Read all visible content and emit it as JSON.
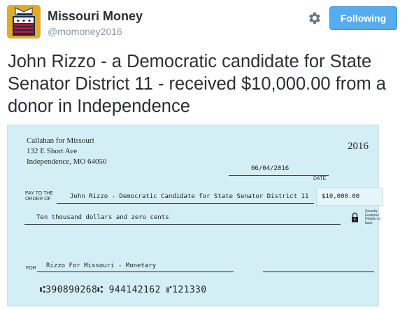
{
  "account": {
    "display_name": "Missouri Money",
    "handle": "@momoney2016"
  },
  "actions": {
    "follow_label": "Following"
  },
  "tweet": {
    "text": "John Rizzo - a Democratic candidate for State Senator District 11 - received $10,000.00 from a donor in Independence"
  },
  "check": {
    "payer_name": "Callahan for Missouri",
    "payer_address_line1": "132 E Short Ave",
    "payer_address_line2": "Independence, MO 64050",
    "year": "2016",
    "date": "06/04/2016",
    "date_label": "DATE",
    "pay_to_label_line1": "PAY TO THE",
    "pay_to_label_line2": "ORDER OF",
    "payee": "John Rizzo - Democratic Candidate for State Senator District 11",
    "amount": "$10,000.00",
    "amount_words": "Ten thousand dollars and zero cents",
    "security_note": "Security Features Details on back",
    "for_label": "FOR",
    "memo": "Rizzo For Missouri - Monetary",
    "micr": "⑆390890268⑆ 944142162 ⑈121330"
  },
  "colors": {
    "follow_button": "#55acee",
    "check_background": "#d4eef5",
    "avatar_background": "#e3a92b"
  },
  "icons": [
    "ballot-box-avatar",
    "gear-icon",
    "padlock-icon"
  ]
}
